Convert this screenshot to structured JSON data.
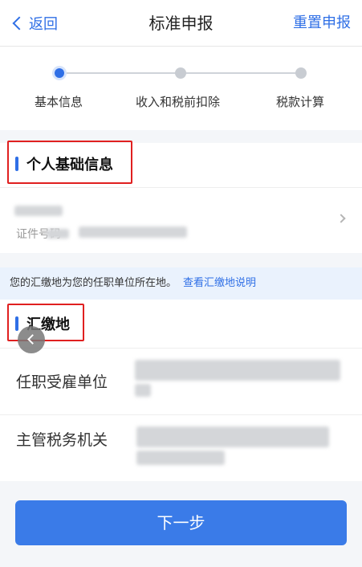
{
  "navbar": {
    "back_label": "返回",
    "title": "标准申报",
    "right_action": "重置申报"
  },
  "steps": [
    {
      "label": "基本信息",
      "state": "active"
    },
    {
      "label": "收入和税前扣除",
      "state": "inactive"
    },
    {
      "label": "税款计算",
      "state": "inactive"
    }
  ],
  "personal_section": {
    "title": "个人基础信息",
    "id_label": "证件号码"
  },
  "notice": {
    "text": "您的汇缴地为您的任职单位所在地。",
    "link": "查看汇缴地说明"
  },
  "location_section": {
    "title": "汇缴地",
    "employer_label": "任职受雇单位",
    "tax_office_label": "主管税务机关"
  },
  "next_button": "下一步",
  "colors": {
    "accent": "#2f6fe6",
    "highlight_box": "#e02020",
    "notice_bg": "#eaf2fd"
  }
}
